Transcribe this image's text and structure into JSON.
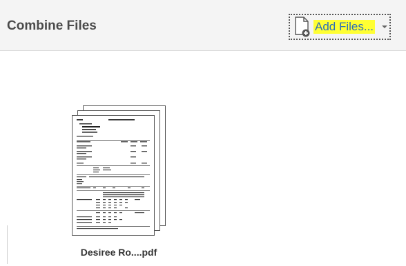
{
  "header": {
    "title": "Combine Files",
    "add_files_label": "Add Files...",
    "highlight_color": "#ffff33",
    "link_color": "#2d6fb8"
  },
  "icons": {
    "add_file": "add-file-icon",
    "dropdown": "chevron-down-icon"
  },
  "files": [
    {
      "name": "Desiree Ro....pdf"
    }
  ]
}
